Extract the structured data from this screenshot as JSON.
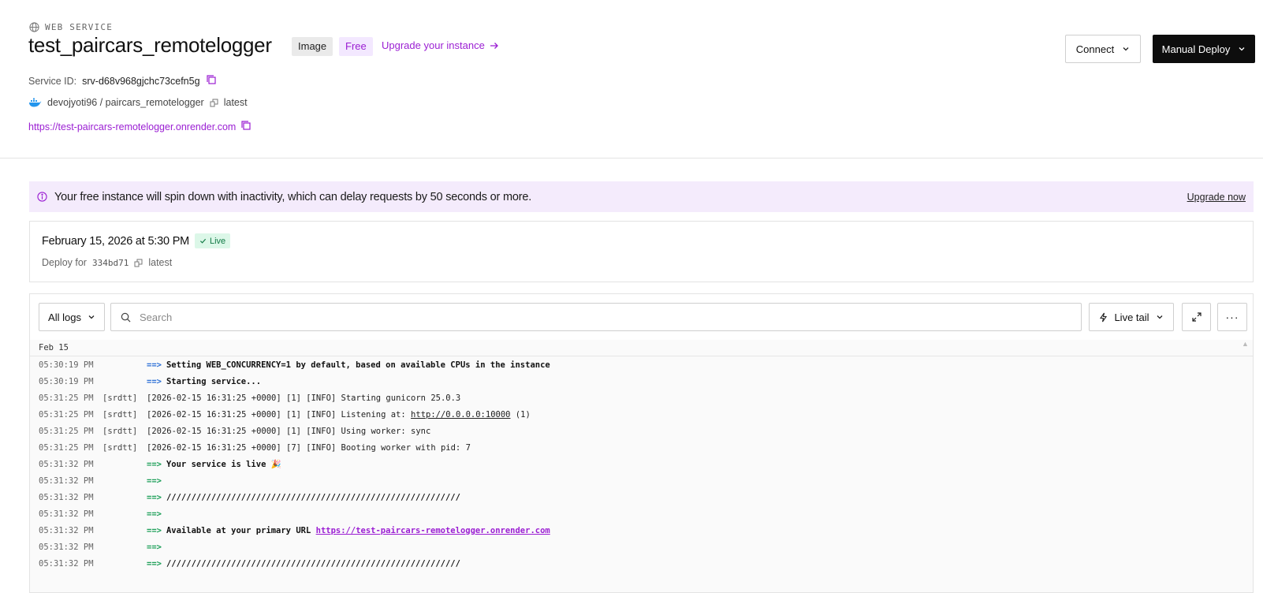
{
  "header": {
    "service_type": "WEB SERVICE",
    "title": "test_paircars_remotelogger",
    "tag_image": "Image",
    "tag_free": "Free",
    "upgrade_instance": "Upgrade your instance",
    "service_id_label": "Service ID:",
    "service_id": "srv-d68v968gjchc73cefn5g",
    "repo": "devojyoti96 / paircars_remotelogger",
    "image_tag": "latest",
    "url": "https://test-paircars-remotelogger.onrender.com",
    "connect_label": "Connect",
    "manual_deploy_label": "Manual Deploy"
  },
  "banner": {
    "text": "Your free instance will spin down with inactivity, which can delay requests by 50 seconds or more.",
    "link": "Upgrade now"
  },
  "deploy": {
    "date": "February 15, 2026 at 5:30 PM",
    "status": "Live",
    "deploy_for_label": "Deploy for",
    "commit": "334bd71",
    "image_tag": "latest"
  },
  "logs": {
    "filter_label": "All logs",
    "search_placeholder": "Search",
    "live_tail_label": "Live tail",
    "more_label": "···",
    "date_header": "Feb 15",
    "lines": [
      {
        "time": "05:30:19 PM",
        "source": "",
        "arrow": "==>",
        "message": "Setting WEB_CONCURRENCY=1 by default, based on available CPUs in the instance"
      },
      {
        "time": "05:30:19 PM",
        "source": "",
        "arrow": "==>",
        "message": "Starting service..."
      },
      {
        "time": "05:31:25 PM",
        "source": "[srdtt]",
        "message": "[2026-02-15 16:31:25 +0000] [1] [INFO] Starting gunicorn 25.0.3"
      },
      {
        "time": "05:31:25 PM",
        "source": "[srdtt]",
        "message_pre": "[2026-02-15 16:31:25 +0000] [1] [INFO] Listening at: ",
        "message_link": "http://0.0.0.0:10000",
        "message_post": " (1)"
      },
      {
        "time": "05:31:25 PM",
        "source": "[srdtt]",
        "message": "[2026-02-15 16:31:25 +0000] [1] [INFO] Using worker: sync"
      },
      {
        "time": "05:31:25 PM",
        "source": "[srdtt]",
        "message": "[2026-02-15 16:31:25 +0000] [7] [INFO] Booting worker with pid: 7"
      },
      {
        "time": "05:31:32 PM",
        "source": "",
        "arrow": "==>",
        "message": "Your service is live 🎉"
      },
      {
        "time": "05:31:32 PM",
        "source": "",
        "arrow": "==>",
        "message": ""
      },
      {
        "time": "05:31:32 PM",
        "source": "",
        "arrow": "==>",
        "message": "///////////////////////////////////////////////////////////"
      },
      {
        "time": "05:31:32 PM",
        "source": "",
        "arrow": "==>",
        "message": ""
      },
      {
        "time": "05:31:32 PM",
        "source": "",
        "arrow": "==>",
        "message": "Available at your primary URL ",
        "message_link": "https://test-paircars-remotelogger.onrender.com"
      },
      {
        "time": "05:31:32 PM",
        "source": "",
        "arrow": "==>",
        "message": ""
      },
      {
        "time": "05:31:32 PM",
        "source": "",
        "arrow": "==>",
        "message": "///////////////////////////////////////////////////////////"
      }
    ]
  },
  "colors": {
    "accent": "#9b1fd3",
    "banner_bg": "#f4ebfc",
    "live_badge_bg": "#dcf7e8",
    "arrow_blue": "#2b6fd6",
    "arrow_green": "#1a9e57",
    "primary_button": "#0d0d0d"
  },
  "icons": [
    "globe-icon",
    "copy-icon",
    "docker-icon",
    "tag-icon",
    "arrow-right-icon",
    "chevron-down-icon",
    "info-icon",
    "check-icon",
    "search-icon",
    "lightning-icon",
    "expand-icon",
    "more-icon"
  ]
}
